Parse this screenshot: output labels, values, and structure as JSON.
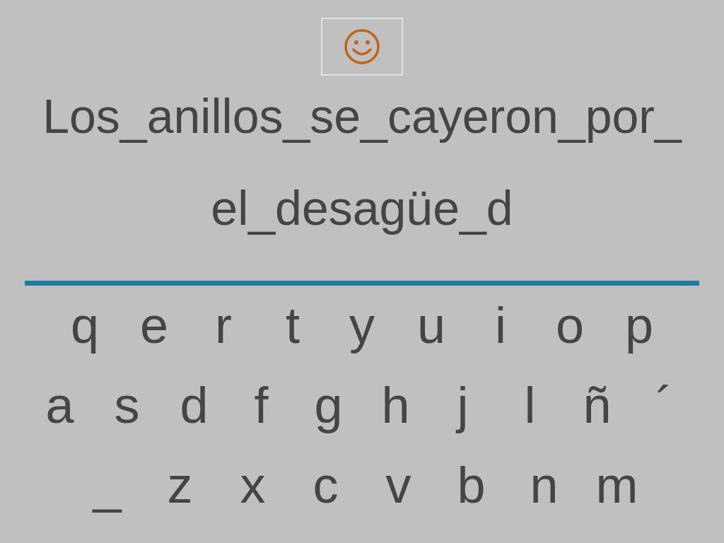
{
  "feedback": {
    "kind": "smiley"
  },
  "sentence": [
    "Los_anillos_se_cayeron_por_",
    "el_desagüe_d"
  ],
  "keyboard": [
    [
      "q",
      "e",
      "r",
      "t",
      "y",
      "u",
      "i",
      "o",
      "p"
    ],
    [
      "a",
      "s",
      "d",
      "f",
      "g",
      "h",
      "j",
      "l",
      "ñ",
      "´"
    ],
    [
      "_",
      "z",
      "x",
      "c",
      "v",
      "b",
      "n",
      "m"
    ]
  ]
}
